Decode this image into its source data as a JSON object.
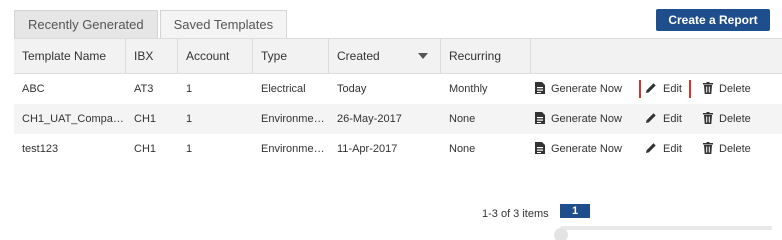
{
  "tabs": [
    {
      "label": "Recently Generated"
    },
    {
      "label": "Saved Templates"
    }
  ],
  "create_button": "Create a Report",
  "columns": {
    "name": "Template Name",
    "ibx": "IBX",
    "account": "Account",
    "type": "Type",
    "created": "Created",
    "recurring": "Recurring"
  },
  "rows": [
    {
      "name": "ABC",
      "ibx": "AT3",
      "account": "1",
      "type": "Electrical",
      "created": "Today",
      "recurring": "Monthly"
    },
    {
      "name": "CH1_UAT_Compar…",
      "ibx": "CH1",
      "account": "1",
      "type": "Environme…",
      "created": "26-May-2017",
      "recurring": "None"
    },
    {
      "name": "test123",
      "ibx": "CH1",
      "account": "1",
      "type": "Environme…",
      "created": "11-Apr-2017",
      "recurring": "None"
    }
  ],
  "actions": {
    "generate": "Generate Now",
    "edit": "Edit",
    "delete": "Delete"
  },
  "pagination": {
    "info": "1-3 of 3 items",
    "current_page": "1"
  },
  "colors": {
    "primary": "#1f4e8c",
    "highlight": "#d9332b"
  },
  "icons": {
    "generate": "report-icon",
    "edit": "pencil-icon",
    "delete": "trash-icon",
    "sort": "sort-desc-icon"
  }
}
